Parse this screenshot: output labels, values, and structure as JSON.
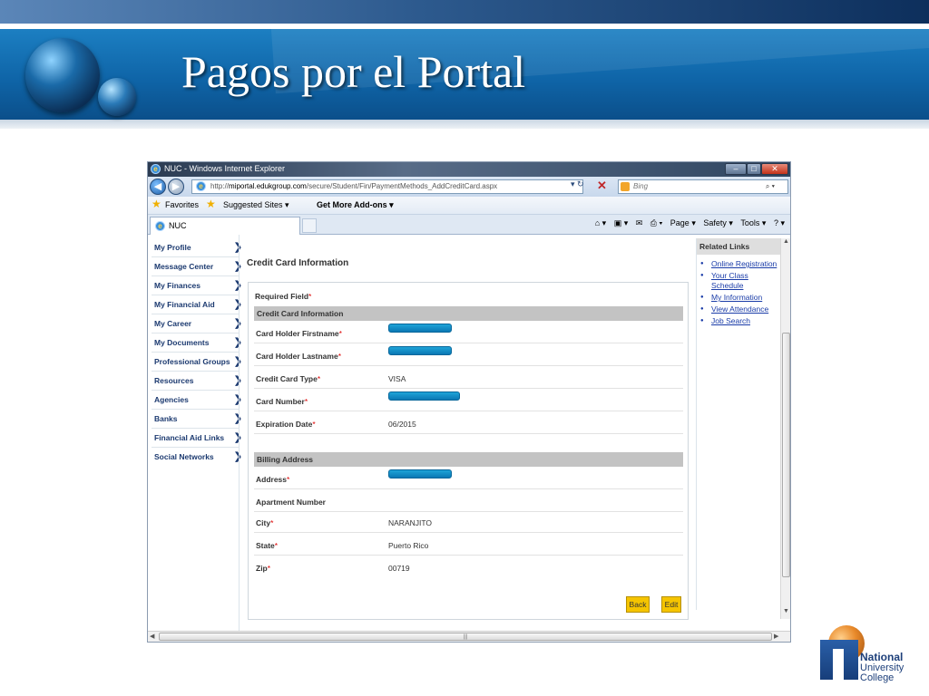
{
  "slide": {
    "title": "Pagos por el Portal"
  },
  "browser": {
    "window_title": "NUC - Windows Internet Explorer",
    "url_prefix": "http://",
    "url_domain": "miportal.edukgroup.com",
    "url_path": "/secure/Student/Fin/PaymentMethods_AddCreditCard.aspx",
    "search_placeholder": "Bing",
    "favorites": {
      "favorites_label": "Favorites",
      "suggested_sites": "Suggested Sites ▾",
      "get_more_addons": "Get More Add-ons ▾"
    },
    "tab_label": "NUC",
    "commands": {
      "page": "Page ▾",
      "safety": "Safety ▾",
      "tools": "Tools ▾"
    }
  },
  "sidebar": {
    "items": [
      {
        "label": "My Profile"
      },
      {
        "label": "Message Center"
      },
      {
        "label": "My Finances"
      },
      {
        "label": "My Financial Aid"
      },
      {
        "label": "My Career"
      },
      {
        "label": "My Documents"
      },
      {
        "label": "Professional Groups"
      },
      {
        "label": "Resources"
      },
      {
        "label": "Agencies"
      },
      {
        "label": "Banks"
      },
      {
        "label": "Financial Aid Links"
      },
      {
        "label": "Social Networks"
      }
    ]
  },
  "main": {
    "title": "Credit Card Information",
    "required_note": "Required Field",
    "section_card": "Credit Card Information",
    "section_billing": "Billing Address",
    "fields": {
      "firstname_label": "Card Holder Firstname",
      "lastname_label": "Card Holder Lastname",
      "card_type_label": "Credit Card Type",
      "card_type_value": "VISA",
      "card_number_label": "Card Number",
      "expiration_label": "Expiration Date",
      "expiration_value": "06/2015",
      "address_label": "Address",
      "apartment_label": "Apartment Number",
      "city_label": "City",
      "city_value": "NARANJITO",
      "state_label": "State",
      "state_value": "Puerto Rico",
      "zip_label": "Zip",
      "zip_value": "00719"
    },
    "buttons": {
      "back": "Back",
      "edit": "Edit"
    }
  },
  "related": {
    "heading": "Related Links",
    "links": [
      {
        "label": "Online Registration"
      },
      {
        "label": "Your Class Schedule"
      },
      {
        "label": "My Information"
      },
      {
        "label": "View Attendance"
      },
      {
        "label": "Job Search"
      }
    ]
  },
  "logo": {
    "line1": "National",
    "line2": "University",
    "line3": "College"
  },
  "colors": {
    "slide_band": "#0f65a8",
    "button": "#f5c400",
    "link": "#1a3ca8",
    "sidebar_text": "#1c3a70",
    "required_asterisk": "#dd0000"
  }
}
